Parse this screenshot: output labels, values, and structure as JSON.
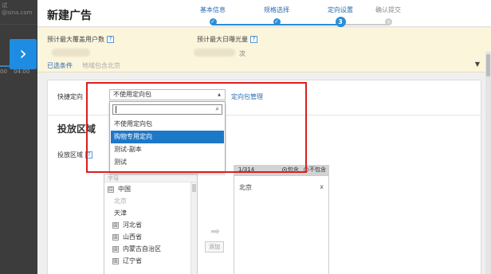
{
  "backdrop": {
    "text_line_1": "试",
    "text_line_2": "@sina.com",
    "time_ticks": [
      "00",
      "04:00"
    ]
  },
  "expand_button": {
    "icon": "chevron-right-icon",
    "glyph": "›"
  },
  "header": {
    "title": "新建广告",
    "steps": [
      {
        "label": "基本信息",
        "marker": "✓",
        "state": "done"
      },
      {
        "label": "规格选择",
        "marker": "✓",
        "state": "done"
      },
      {
        "label": "定向设置",
        "marker": "3",
        "state": "active"
      },
      {
        "label": "确认提交",
        "marker": "",
        "state": "pending"
      }
    ]
  },
  "info_bar": {
    "max_users_label": "预计最大覆盖用户数",
    "max_impressions_label": "预计最大日曝光量",
    "help_glyph": "?",
    "impressions_unit": "次",
    "selected_conditions_link": "已选条件",
    "selected_conditions_value": "地域包含北京",
    "collapse_glyph": "▼"
  },
  "form": {
    "quick_targeting_label": "快捷定向",
    "quick_targeting_value": "不使用定向包",
    "select_arrow": "▲",
    "manage_link": "定向包管理",
    "section_title": "投放区域",
    "area_label": "投放区域",
    "dropdown": {
      "search_value": "",
      "search_icon": "⌕",
      "options": [
        {
          "label": "不使用定向包",
          "highlighted": false
        },
        {
          "label": "购物专用定向",
          "highlighted": true
        },
        {
          "label": "测试-副本",
          "highlighted": false
        },
        {
          "label": "测试",
          "highlighted": false
        }
      ]
    },
    "tree": {
      "header_text": "字母",
      "items": [
        {
          "toggle": "⊟",
          "label": "中国",
          "muted": false
        },
        {
          "toggle": "",
          "label": "北京",
          "muted": true
        },
        {
          "toggle": "",
          "label": "天津",
          "muted": false
        },
        {
          "toggle": "⊞",
          "label": "河北省",
          "muted": false
        },
        {
          "toggle": "⊞",
          "label": "山西省",
          "muted": false
        },
        {
          "toggle": "⊞",
          "label": "内蒙古自治区",
          "muted": false
        },
        {
          "toggle": "⊞",
          "label": "辽宁省",
          "muted": false
        }
      ]
    },
    "add_arrow": "➡",
    "add_button": "添加",
    "selected_panel": {
      "count": "1/314",
      "include_label": "包含",
      "exclude_label": "不包含",
      "include_selected": true,
      "items": [
        "北京"
      ],
      "remove_glyph": "x"
    }
  },
  "colors": {
    "accent": "#2b8dd6",
    "highlight": "#1e78c8",
    "annotation_frame": "#d91e1e",
    "info_bar_bg": "#fbf5dc"
  }
}
